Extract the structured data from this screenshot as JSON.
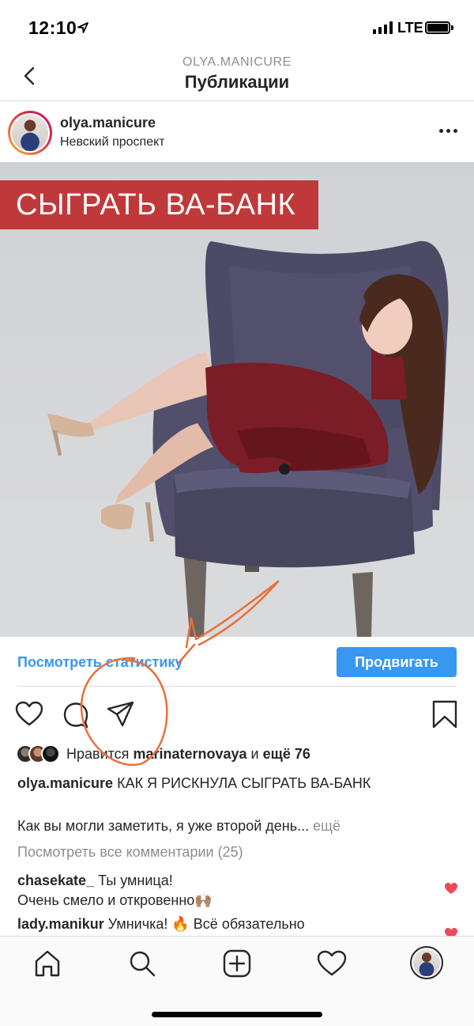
{
  "status": {
    "time": "12:10",
    "network": "LTE"
  },
  "nav": {
    "subtitle": "OLYA.MANICURE",
    "title": "Публикации"
  },
  "post": {
    "username": "olya.manicure",
    "location": "Невский проспект",
    "banner": "СЫГРАТЬ ВА-БАНК",
    "stats_link": "Посмотреть статистику",
    "promote": "Продвигать",
    "likes": {
      "prefix": "Нравится",
      "user": "marinaternovaya",
      "conj": "и",
      "rest": "ещё 76"
    },
    "caption": {
      "user": "olya.manicure",
      "text": "КАК Я РИСКНУЛА СЫГРАТЬ ВА-БАНК"
    },
    "caption_more": {
      "text": "Как вы могли заметить, я уже второй день...",
      "more": "ещё"
    },
    "view_comments": "Посмотреть все комментарии (25)",
    "comments": [
      {
        "user": "chasekate_",
        "text": "Ты умница!",
        "text2": "Очень смело и откровенно🙌🏽"
      },
      {
        "user": "lady.manikur",
        "text": "Умничка! 🔥 Всё обязательно"
      }
    ]
  },
  "colors": {
    "accent": "#3897f0",
    "banner": "#c0393a",
    "annotation": "#e8703a",
    "heart": "#ed4956"
  }
}
